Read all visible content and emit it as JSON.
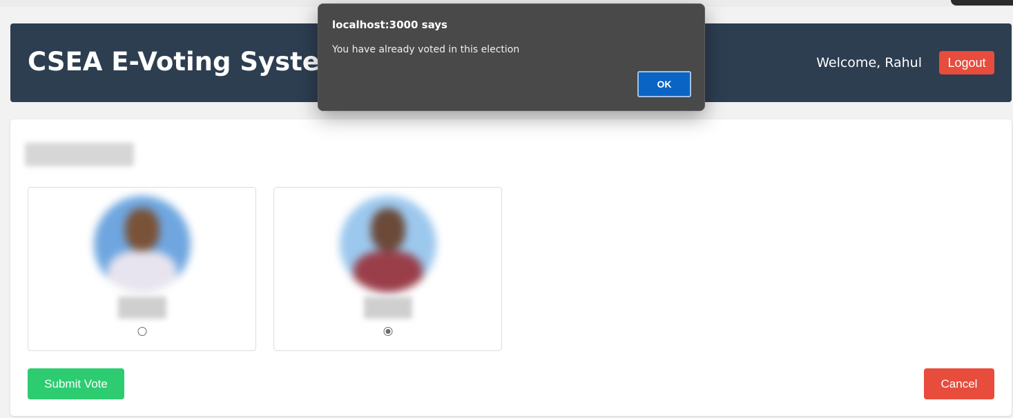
{
  "header": {
    "title": "CSEA E-Voting System",
    "welcome_text": "Welcome, Rahul",
    "logout_label": "Logout"
  },
  "ballot": {
    "candidates": [
      {
        "selected": false
      },
      {
        "selected": true
      }
    ],
    "submit_label": "Submit Vote",
    "cancel_label": "Cancel"
  },
  "dialog": {
    "title": "localhost:3000 says",
    "message": "You have already voted in this election",
    "ok_label": "OK"
  },
  "colors": {
    "header_bg": "#2c3e50",
    "logout_bg": "#e74c3c",
    "submit_bg": "#2ecc71",
    "cancel_bg": "#e74c3c",
    "dialog_bg": "#494949",
    "dialog_ok_bg": "#0a64c4"
  }
}
